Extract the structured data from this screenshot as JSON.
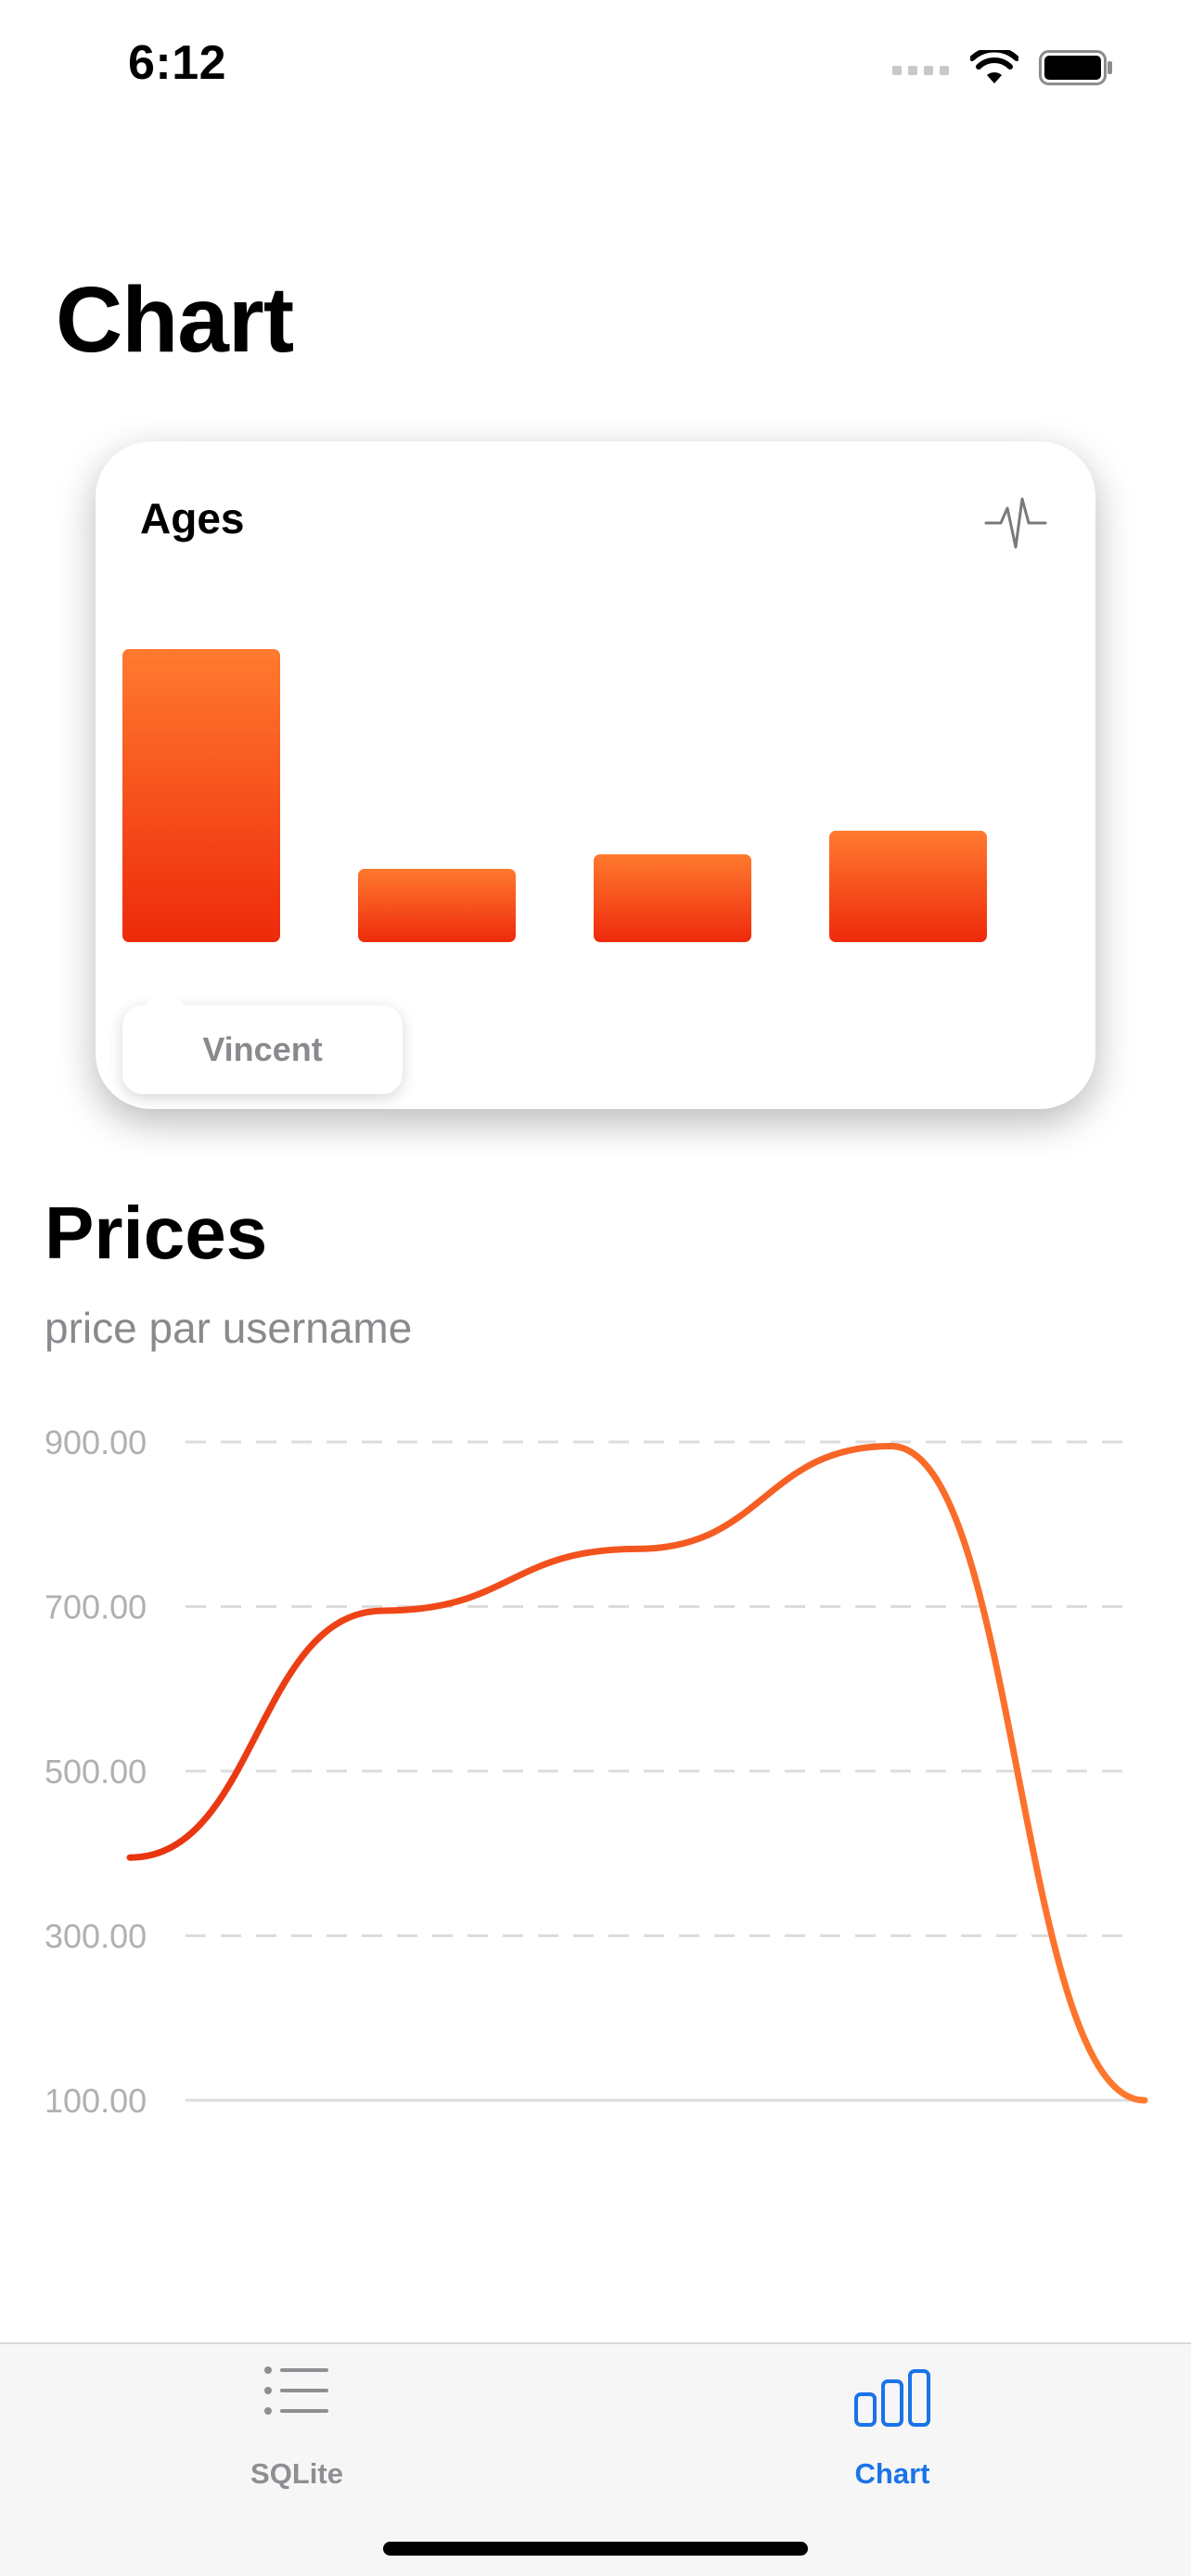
{
  "status_bar": {
    "time": "6:12",
    "icons": [
      "signal-icon",
      "wifi-icon",
      "battery-icon"
    ]
  },
  "page": {
    "title": "Chart"
  },
  "ages_card": {
    "title": "Ages",
    "icon": "pulse-icon",
    "tooltip": "Vincent",
    "chart_data": {
      "type": "bar",
      "title": "Ages",
      "values": [
        100,
        25,
        30,
        38
      ],
      "highlighted_index": 0,
      "highlighted_label": "Vincent",
      "colors": {
        "top": "#FF7A2F",
        "bottom": "#EE2A0B"
      }
    }
  },
  "prices": {
    "title": "Prices",
    "subtitle": "price par username",
    "y_ticks": [
      "900.00",
      "700.00",
      "500.00",
      "300.00",
      "100.00"
    ],
    "chart_data": {
      "type": "line",
      "title": "Prices",
      "subtitle": "price par username",
      "ylim": [
        100,
        900
      ],
      "yticks": [
        900,
        700,
        500,
        300,
        100
      ],
      "x": [
        0,
        1,
        2,
        3,
        4
      ],
      "values": [
        395,
        695,
        770,
        895,
        100
      ],
      "grid": "dashed horizontal",
      "colors": {
        "start": "#E8330F",
        "end": "#FF7A2F"
      }
    }
  },
  "tab_bar": {
    "tabs": [
      {
        "label": "SQLite",
        "icon": "list-icon",
        "active": false
      },
      {
        "label": "Chart",
        "icon": "bar-chart-icon",
        "active": true
      }
    ],
    "active_color": "#1A73E8",
    "inactive_color": "#8E8E93"
  }
}
